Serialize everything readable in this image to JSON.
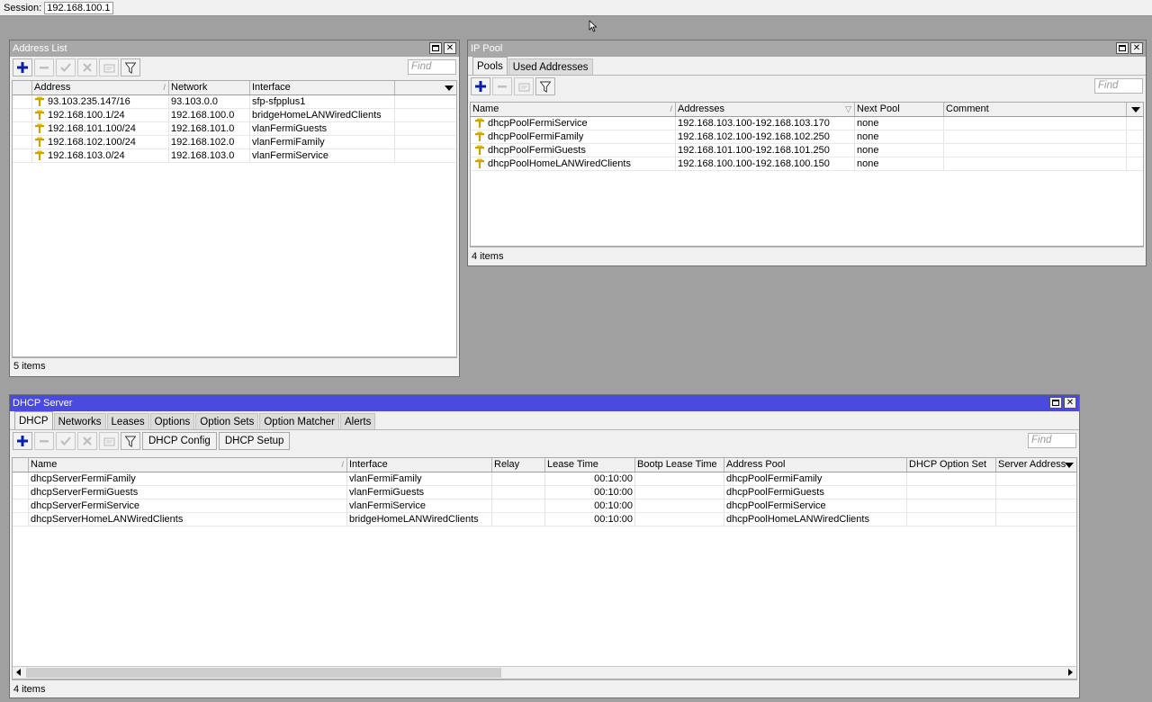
{
  "session": {
    "label": "Session:",
    "value": "192.168.100.1"
  },
  "address_list": {
    "title": "Address List",
    "find_placeholder": "Find",
    "columns": {
      "address": "Address",
      "network": "Network",
      "interface": "Interface"
    },
    "rows": [
      {
        "address": "93.103.235.147/16",
        "network": "93.103.0.0",
        "interface": "sfp-sfpplus1"
      },
      {
        "address": "192.168.100.1/24",
        "network": "192.168.100.0",
        "interface": "bridgeHomeLANWiredClients"
      },
      {
        "address": "192.168.101.100/24",
        "network": "192.168.101.0",
        "interface": "vlanFermiGuests"
      },
      {
        "address": "192.168.102.100/24",
        "network": "192.168.102.0",
        "interface": "vlanFermiFamily"
      },
      {
        "address": "192.168.103.0/24",
        "network": "192.168.103.0",
        "interface": "vlanFermiService"
      }
    ],
    "status": "5 items"
  },
  "ip_pool": {
    "title": "IP Pool",
    "tabs": [
      "Pools",
      "Used Addresses"
    ],
    "find_placeholder": "Find",
    "columns": {
      "name": "Name",
      "addresses": "Addresses",
      "next_pool": "Next Pool",
      "comment": "Comment"
    },
    "rows": [
      {
        "name": "dhcpPoolFermiService",
        "addresses": "192.168.103.100-192.168.103.170",
        "next_pool": "none",
        "comment": ""
      },
      {
        "name": "dhcpPoolFermiFamily",
        "addresses": "192.168.102.100-192.168.102.250",
        "next_pool": "none",
        "comment": ""
      },
      {
        "name": "dhcpPoolFermiGuests",
        "addresses": "192.168.101.100-192.168.101.250",
        "next_pool": "none",
        "comment": ""
      },
      {
        "name": "dhcpPoolHomeLANWiredClients",
        "addresses": "192.168.100.100-192.168.100.150",
        "next_pool": "none",
        "comment": ""
      }
    ],
    "status": "4 items"
  },
  "dhcp_server": {
    "title": "DHCP Server",
    "tabs": [
      "DHCP",
      "Networks",
      "Leases",
      "Options",
      "Option Sets",
      "Option Matcher",
      "Alerts"
    ],
    "toolbar": {
      "config": "DHCP Config",
      "setup": "DHCP Setup"
    },
    "find_placeholder": "Find",
    "columns": {
      "name": "Name",
      "interface": "Interface",
      "relay": "Relay",
      "lease_time": "Lease Time",
      "bootp_lease_time": "Bootp Lease Time",
      "address_pool": "Address Pool",
      "option_set": "DHCP Option Set",
      "server_address": "Server Address"
    },
    "rows": [
      {
        "name": "dhcpServerFermiFamily",
        "interface": "vlanFermiFamily",
        "relay": "",
        "lease_time": "00:10:00",
        "bootp": "",
        "pool": "dhcpPoolFermiFamily",
        "option_set": "",
        "server_address": ""
      },
      {
        "name": "dhcpServerFermiGuests",
        "interface": "vlanFermiGuests",
        "relay": "",
        "lease_time": "00:10:00",
        "bootp": "",
        "pool": "dhcpPoolFermiGuests",
        "option_set": "",
        "server_address": ""
      },
      {
        "name": "dhcpServerFermiService",
        "interface": "vlanFermiService",
        "relay": "",
        "lease_time": "00:10:00",
        "bootp": "",
        "pool": "dhcpPoolFermiService",
        "option_set": "",
        "server_address": ""
      },
      {
        "name": "dhcpServerHomeLANWiredClients",
        "interface": "bridgeHomeLANWiredClients",
        "relay": "",
        "lease_time": "00:10:00",
        "bootp": "",
        "pool": "dhcpPoolHomeLANWiredClients",
        "option_set": "",
        "server_address": ""
      }
    ],
    "status": "4 items"
  },
  "colors": {
    "active_title": "#4a4ade",
    "inactive_title": "#a8a8a8",
    "desktop": "#a0a0a0",
    "add_icon": "#0a1fa8",
    "pin_icon": "#c8a400"
  }
}
